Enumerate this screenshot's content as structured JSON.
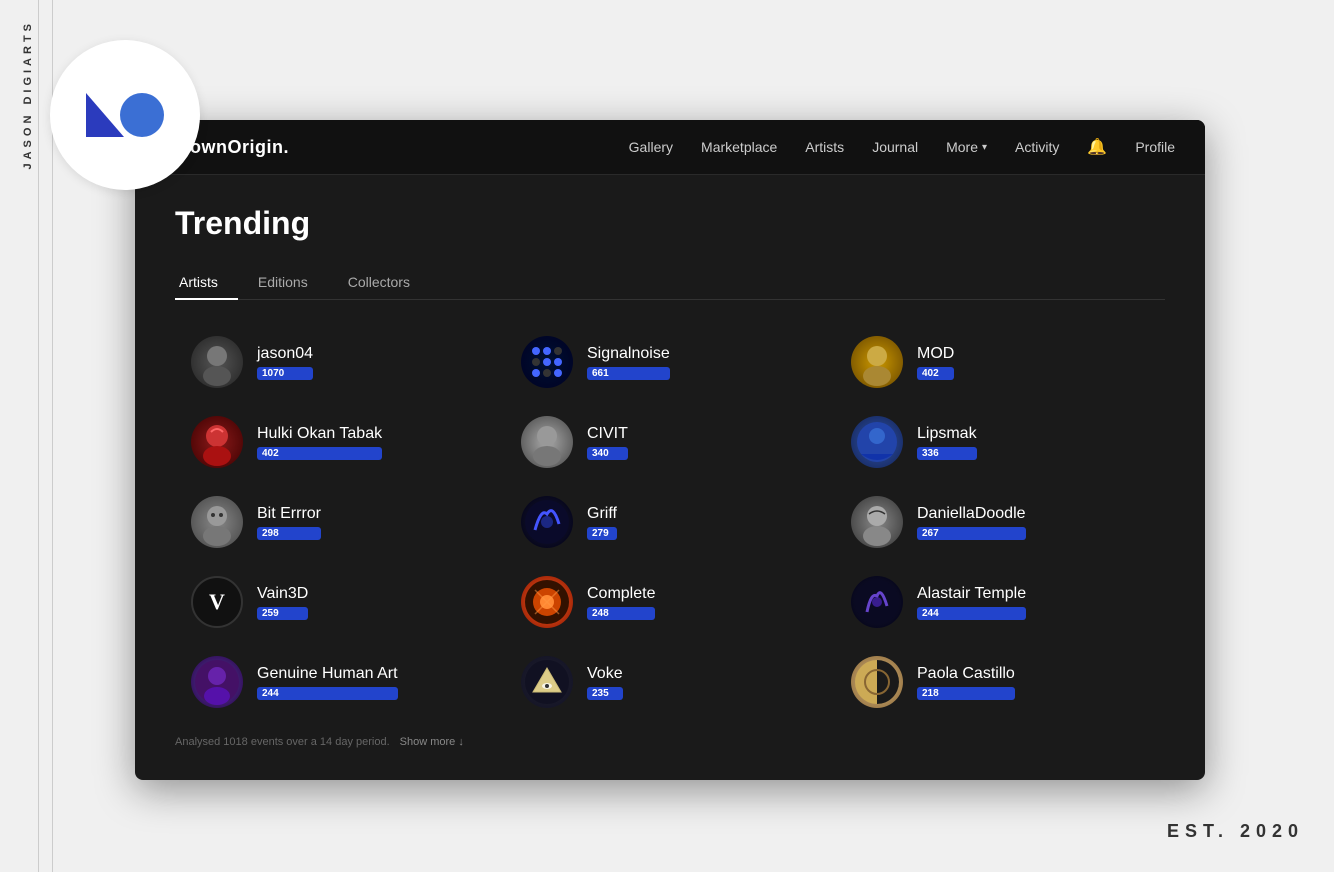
{
  "page": {
    "background": "#f0f0f0"
  },
  "watermark": {
    "side_text": "JASON DIGIARTS",
    "est_text": "EST. 2020"
  },
  "navbar": {
    "logo": "KnownOrigin.",
    "links": [
      {
        "id": "gallery",
        "label": "Gallery"
      },
      {
        "id": "marketplace",
        "label": "Marketplace"
      },
      {
        "id": "artists",
        "label": "Artists"
      },
      {
        "id": "journal",
        "label": "Journal"
      },
      {
        "id": "more",
        "label": "More"
      },
      {
        "id": "activity",
        "label": "Activity"
      },
      {
        "id": "profile",
        "label": "Profile"
      }
    ]
  },
  "trending": {
    "title": "Trending",
    "tabs": [
      {
        "id": "artists",
        "label": "Artists",
        "active": true
      },
      {
        "id": "editions",
        "label": "Editions",
        "active": false
      },
      {
        "id": "collectors",
        "label": "Collectors",
        "active": false
      }
    ],
    "artists": [
      {
        "id": "jason04",
        "name": "jason04",
        "score": "1070",
        "col": 0
      },
      {
        "id": "hulki",
        "name": "Hulki Okan Tabak",
        "score": "402",
        "col": 0
      },
      {
        "id": "biterrror",
        "name": "Bit Errror",
        "score": "298",
        "col": 0
      },
      {
        "id": "vain3d",
        "name": "Vain3D",
        "score": "259",
        "col": 0
      },
      {
        "id": "genuine",
        "name": "Genuine Human Art",
        "score": "244",
        "col": 0
      },
      {
        "id": "signalnoise",
        "name": "Signalnoise",
        "score": "661",
        "col": 1
      },
      {
        "id": "civit",
        "name": "CIVIT",
        "score": "340",
        "col": 1
      },
      {
        "id": "griff",
        "name": "Griff",
        "score": "279",
        "col": 1
      },
      {
        "id": "complete",
        "name": "Complete",
        "score": "248",
        "col": 1
      },
      {
        "id": "voke",
        "name": "Voke",
        "score": "235",
        "col": 1
      },
      {
        "id": "mod",
        "name": "MOD",
        "score": "402",
        "col": 2
      },
      {
        "id": "lipsmak",
        "name": "Lipsmak",
        "score": "336",
        "col": 2
      },
      {
        "id": "daniella",
        "name": "DaniellaDoodle",
        "score": "267",
        "col": 2
      },
      {
        "id": "alastair",
        "name": "Alastair Temple",
        "score": "244",
        "col": 2
      },
      {
        "id": "paola",
        "name": "Paola Castillo",
        "score": "218",
        "col": 2
      }
    ],
    "footer_text": "Analysed 1018 events over a 14 day period.",
    "show_more_label": "Show more ↓"
  }
}
